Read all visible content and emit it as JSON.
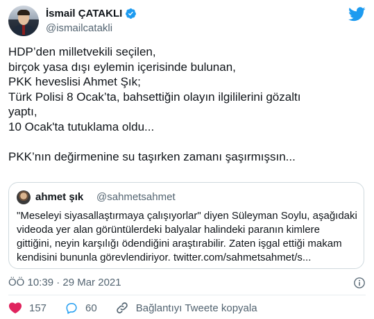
{
  "author": {
    "display_name": "İsmail ÇATAKLI",
    "handle": "@ismailcatakli"
  },
  "tweet": {
    "lines": [
      "HDP’den milletvekili seçilen,",
      "birçok yasa dışı eylemin içerisinde bulunan,",
      "PKK heveslisi Ahmet Şık;",
      "Türk Polisi 8 Ocak’ta, bahsettiğin olayın ilgililerini gözaltı",
      "yaptı,",
      "10 Ocak'ta tutuklama oldu...",
      "PKK’nın değirmenine su taşırken zamanı şaşırmışsın..."
    ]
  },
  "quoted_tweet": {
    "display_name": "ahmet şık",
    "handle": "@sahmetsahmet",
    "lines": [
      "\"Meseleyi siyasallaştırmaya çalışıyorlar\" diyen Süleyman Soylu, aşağıdaki",
      "videoda yer alan görüntülerdeki balyalar halindeki paranın kimlere",
      "gittiğini, neyin karşılığı ödendiğini araştırabilir. Zaten işgal ettiği makam",
      "kendisini bununla görevlendiriyor. twitter.com/sahmetsahmet/s..."
    ]
  },
  "meta": {
    "timestamp": "ÖÖ 10:39 · 29 Mar 2021"
  },
  "actions": {
    "likes": "157",
    "replies": "60",
    "copy_link_label": "Bağlantıyı Tweete kopyala"
  },
  "colors": {
    "accent": "#1d9bf0",
    "like": "#e0245e",
    "secondary_text": "#536471",
    "border": "#cfd9de"
  },
  "icons": [
    "verified-badge-icon",
    "twitter-bird-icon",
    "info-icon",
    "heart-icon",
    "reply-icon",
    "link-icon"
  ]
}
